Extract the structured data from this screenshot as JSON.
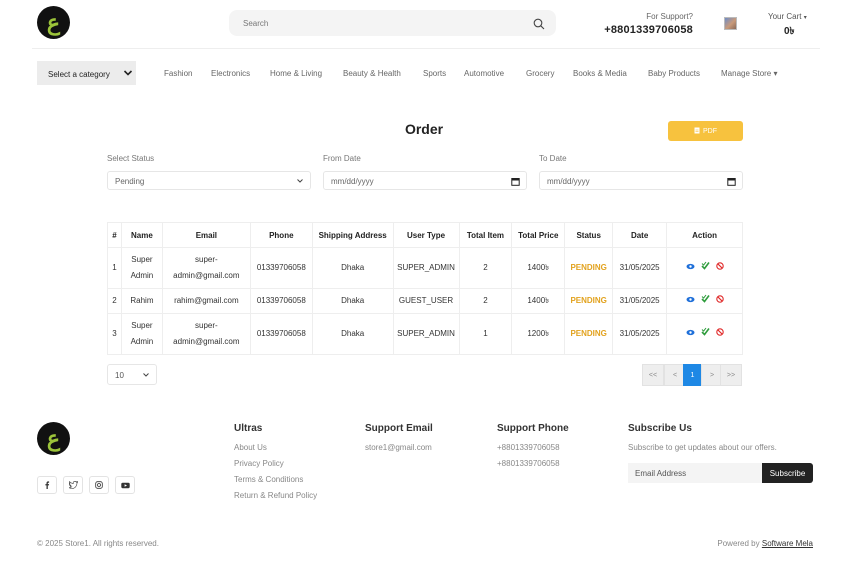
{
  "header": {
    "logo_letter": "ع",
    "search_placeholder": "Search",
    "support_label": "For Support?",
    "support_phone": "+8801339706058",
    "cart_label": "Your Cart",
    "cart_caret": "▾",
    "cart_value": "0৳"
  },
  "nav": {
    "category_label": "Select a category",
    "items": [
      "Fashion",
      "Electronics",
      "Home & Living",
      "Beauty & Health",
      "Sports",
      "Automotive",
      "Grocery",
      "Books & Media",
      "Baby Products",
      "Manage Store ▾"
    ]
  },
  "page": {
    "title": "Order",
    "pdf_label": "PDF"
  },
  "filters": {
    "status_label": "Select Status",
    "status_value": "Pending",
    "from_label": "From Date",
    "from_placeholder": "mm/dd/yyyy",
    "to_label": "To Date",
    "to_placeholder": "mm/dd/yyyy"
  },
  "table": {
    "headers": [
      "#",
      "Name",
      "Email",
      "Phone",
      "Shipping Address",
      "User Type",
      "Total Item",
      "Total Price",
      "Status",
      "Date",
      "Action"
    ],
    "rows": [
      {
        "n": "1",
        "name": "Super Admin",
        "email": "super-admin@gmail.com",
        "phone": "01339706058",
        "address": "Dhaka",
        "type": "SUPER_ADMIN",
        "items": "2",
        "price": "1400৳",
        "status": "PENDING",
        "date": "31/05/2025"
      },
      {
        "n": "2",
        "name": "Rahim",
        "email": "rahim@gmail.com",
        "phone": "01339706058",
        "address": "Dhaka",
        "type": "GUEST_USER",
        "items": "2",
        "price": "1400৳",
        "status": "PENDING",
        "date": "31/05/2025"
      },
      {
        "n": "3",
        "name": "Super Admin",
        "email": "super-admin@gmail.com",
        "phone": "01339706058",
        "address": "Dhaka",
        "type": "SUPER_ADMIN",
        "items": "1",
        "price": "1200৳",
        "status": "PENDING",
        "date": "31/05/2025"
      }
    ]
  },
  "pagination": {
    "per_page": "10",
    "buttons": [
      "<<",
      "<",
      "1",
      ">",
      ">>"
    ]
  },
  "footer": {
    "col1_title": "Ultras",
    "col1_links": [
      "About Us",
      "Privacy Policy",
      "Terms & Conditions",
      "Return & Refund Policy"
    ],
    "col2_title": "Support Email",
    "col2_email": "store1@gmail.com",
    "col3_title": "Support Phone",
    "col3_phones": [
      "+8801339706058",
      "+8801339706058"
    ],
    "col4_title": "Subscribe Us",
    "col4_text": "Subscribe to get updates about our offers.",
    "email_placeholder": "Email Address",
    "subscribe_label": "Subscribe",
    "copyright": "© 2025 Store1. All rights reserved.",
    "powered_by": "Powered by",
    "powered_link": "Software Mela"
  },
  "colors": {
    "pending": "#e2a21e",
    "pdf_button": "#f7c23e",
    "active_page": "#1e88e5",
    "view_icon": "#1e6fd9",
    "approve_icon": "#2e9c3c",
    "cancel_icon": "#e02929"
  }
}
